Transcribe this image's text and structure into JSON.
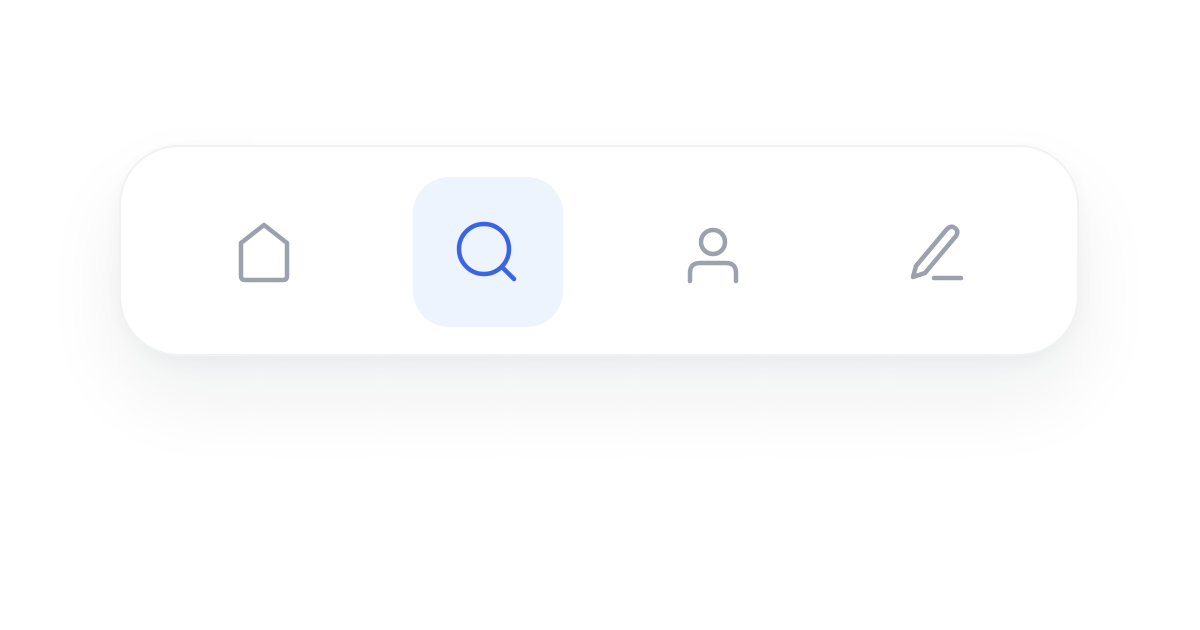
{
  "colors": {
    "inactive_icon": "#9ca1ad",
    "active_icon": "#3a63e6",
    "active_background": "#edf4fe",
    "bar_background": "#ffffff",
    "bar_border": "#f1f2f4"
  },
  "nav": {
    "active_index": 1,
    "items": [
      {
        "icon": "home-icon",
        "active": false
      },
      {
        "icon": "search-icon",
        "active": true
      },
      {
        "icon": "user-icon",
        "active": false
      },
      {
        "icon": "pencil-icon",
        "active": false
      }
    ]
  }
}
